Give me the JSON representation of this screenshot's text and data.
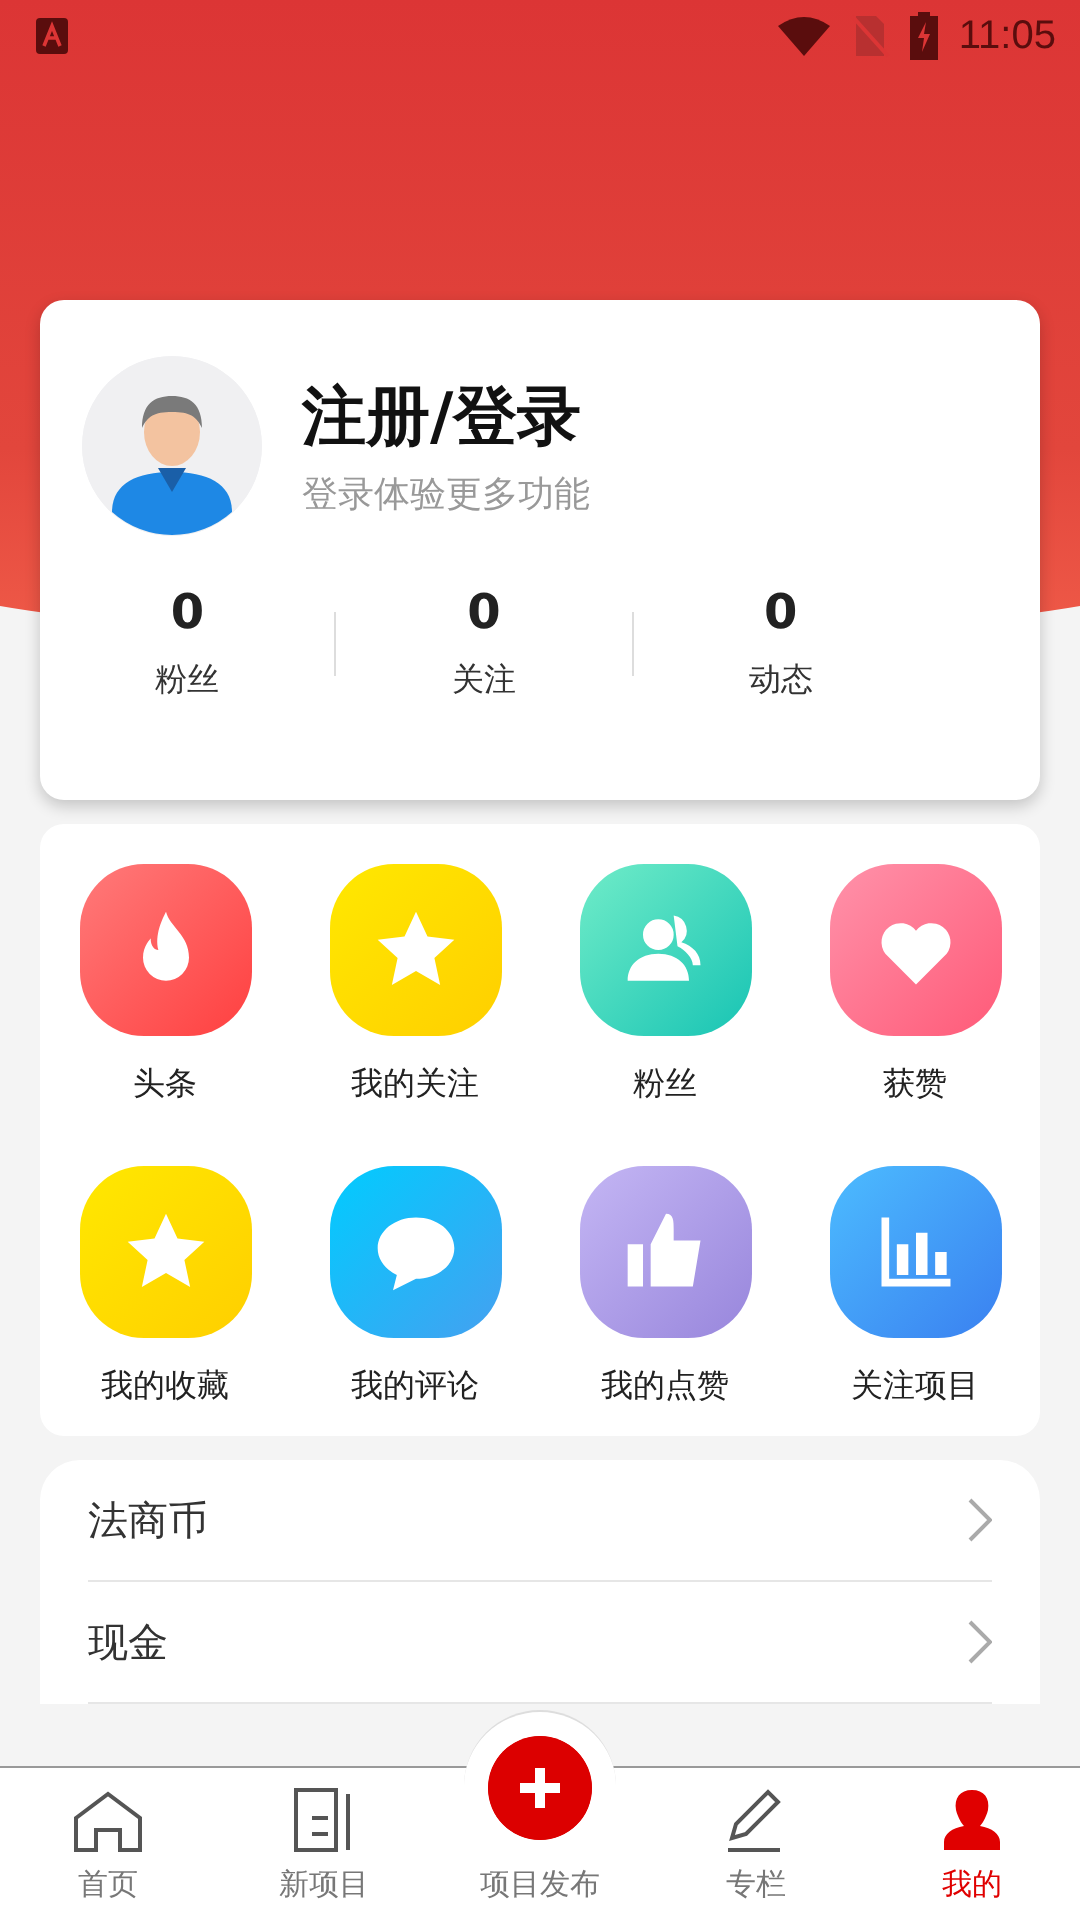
{
  "status_bar": {
    "time": "11:05"
  },
  "profile": {
    "title": "注册/登录",
    "subtitle": "登录体验更多功能",
    "stats": [
      {
        "value": "0",
        "label": "粉丝"
      },
      {
        "value": "0",
        "label": "关注"
      },
      {
        "value": "0",
        "label": "动态"
      }
    ]
  },
  "shortcuts": [
    {
      "kind": "flame",
      "label": "头条"
    },
    {
      "kind": "star",
      "label": "我的关注"
    },
    {
      "kind": "fans",
      "label": "粉丝"
    },
    {
      "kind": "heart",
      "label": "获赞"
    },
    {
      "kind": "star",
      "label": "我的收藏"
    },
    {
      "kind": "comment",
      "label": "我的评论"
    },
    {
      "kind": "thumb",
      "label": "我的点赞"
    },
    {
      "kind": "chart",
      "label": "关注项目"
    }
  ],
  "menu": [
    {
      "label": "法商币"
    },
    {
      "label": "现金"
    }
  ],
  "bottom_nav": [
    {
      "kind": "home",
      "label": "首页",
      "selected": false
    },
    {
      "kind": "doc",
      "label": "新项目",
      "selected": false
    },
    {
      "kind": "publish",
      "label": "项目发布",
      "selected": false
    },
    {
      "kind": "pen",
      "label": "专栏",
      "selected": false
    },
    {
      "kind": "person",
      "label": "我的",
      "selected": true
    }
  ]
}
